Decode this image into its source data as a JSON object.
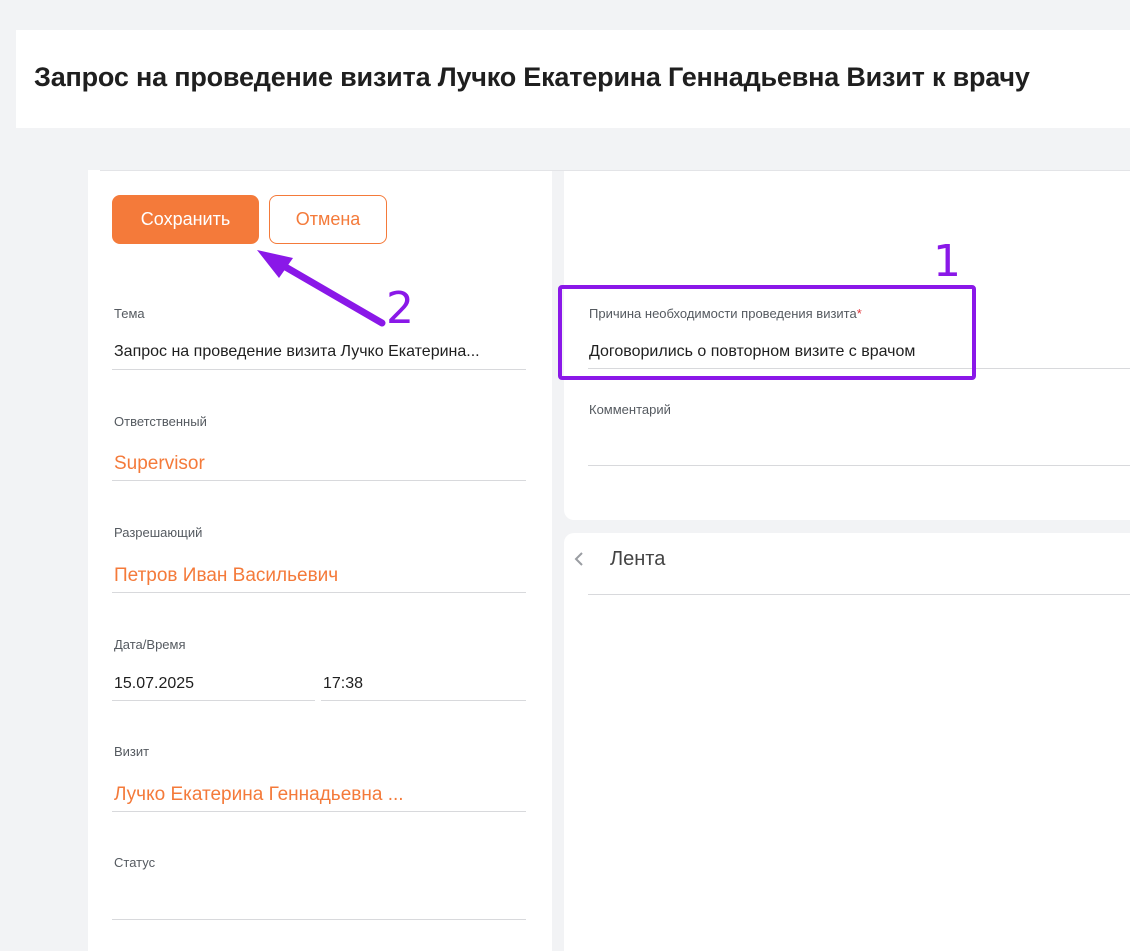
{
  "page": {
    "title": "Запрос на проведение визита Лучко Екатерина Геннадьевна Визит к врачу"
  },
  "toolbar": {
    "save_label": "Сохранить",
    "cancel_label": "Отмена"
  },
  "form": {
    "topic": {
      "label": "Тема",
      "value": "Запрос на проведение визита Лучко Екатерина..."
    },
    "responsible": {
      "label": "Ответственный",
      "value": "Supervisor"
    },
    "approver": {
      "label": "Разрешающий",
      "value": "Петров Иван Васильевич"
    },
    "datetime": {
      "label": "Дата/Время",
      "date": "15.07.2025",
      "time": "17:38"
    },
    "visit": {
      "label": "Визит",
      "value": "Лучко Екатерина Геннадьевна ..."
    },
    "status": {
      "label": "Статус",
      "value": ""
    },
    "reason": {
      "label": "Причина необходимости проведения визита",
      "required_mark": "*",
      "value": "Договорились о повторном визите с врачом"
    },
    "comment": {
      "label": "Комментарий",
      "value": ""
    }
  },
  "feed": {
    "title": "Лента",
    "collapse_icon": "chevron-left-icon"
  },
  "annotations": {
    "box_number": "1",
    "arrow_number": "2",
    "color": "#8a18e8"
  },
  "colors": {
    "accent": "#f47a3a",
    "required": "#e0353b"
  }
}
